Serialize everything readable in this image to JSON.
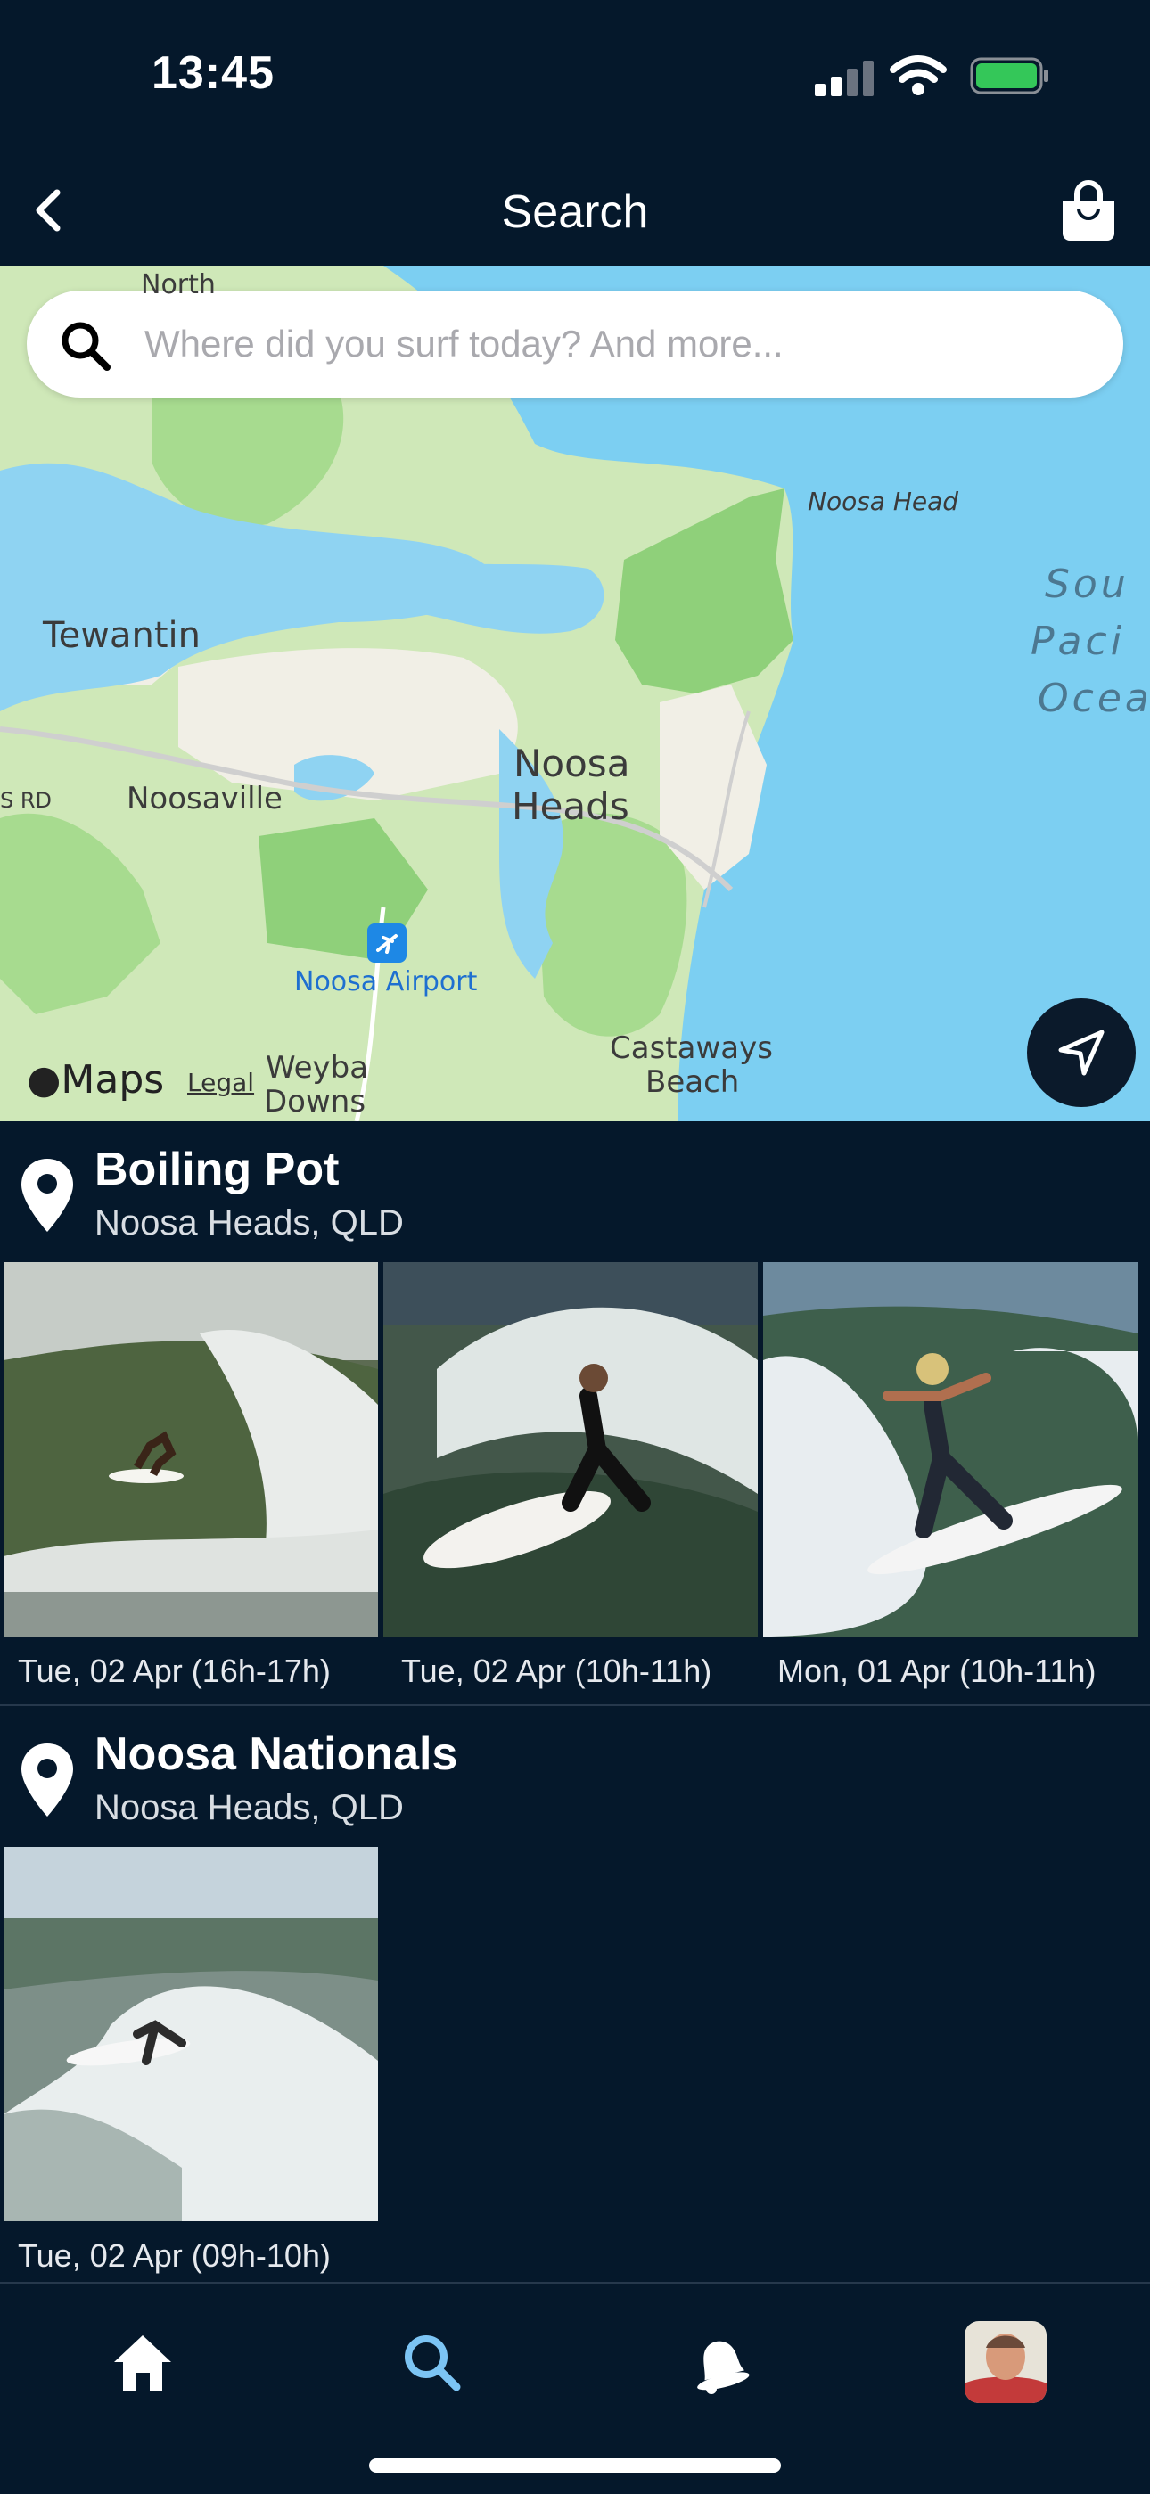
{
  "status_bar": {
    "time": "13:45",
    "battery_color": "#34c759"
  },
  "nav": {
    "title": "Search",
    "back_icon": "chevron-left-icon",
    "bag_icon": "shopping-bag-icon"
  },
  "search": {
    "placeholder": "Where did you surf today? And more...",
    "value": ""
  },
  "map": {
    "labels": {
      "north": "North",
      "tewantin": "Tewantin",
      "noosa_head": "Noosa Head",
      "south_pacific_1": "Sou",
      "south_pacific_2": "Paci",
      "south_pacific_3": "Ocea",
      "rd": "S RD",
      "noosaville": "Noosaville",
      "noosa_heads_1": "Noosa",
      "noosa_heads_2": "Heads",
      "noosa_airport": "Noosa Airport",
      "castaways_1": "Castaways",
      "castaways_2": "Beach",
      "weyba_1": "Weyba",
      "weyba_2": "Downs"
    },
    "attribution": {
      "maps": "Maps",
      "legal": "Legal"
    },
    "colors": {
      "water": "#7ccff2",
      "land": "#cfe8b8",
      "park": "#8fd07a",
      "urban": "#f1efe6"
    }
  },
  "spots": [
    {
      "name": "Boiling Pot",
      "location": "Noosa Heads, QLD",
      "sessions": [
        {
          "caption": "Tue, 02 Apr (16h-17h)"
        },
        {
          "caption": "Tue, 02 Apr (10h-11h)"
        },
        {
          "caption": "Mon, 01 Apr (10h-11h)"
        }
      ]
    },
    {
      "name": "Noosa Nationals",
      "location": "Noosa Heads, QLD",
      "sessions": [
        {
          "caption": "Tue, 02 Apr (09h-10h)"
        }
      ]
    }
  ],
  "tabs": [
    {
      "name": "home",
      "icon": "home-icon",
      "active": false
    },
    {
      "name": "search",
      "icon": "search-icon",
      "active": true
    },
    {
      "name": "notifications",
      "icon": "bell-icon",
      "active": false
    },
    {
      "name": "profile",
      "icon": "avatar",
      "active": false
    }
  ],
  "accent_color": "#7cc4f4"
}
